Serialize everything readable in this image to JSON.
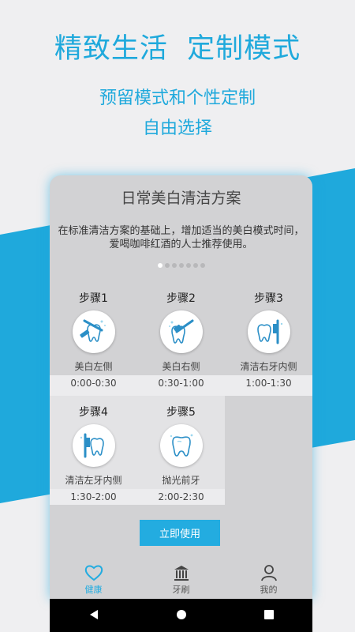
{
  "hero": {
    "title": "精致生活  定制模式",
    "subtitle1": "预留模式和个性定制",
    "subtitle2": "自由选择"
  },
  "card": {
    "title": "日常美白清洁方案",
    "description": "在标准清洁方案的基础上，增加适当的美白模式时间，爱喝咖啡红酒的人士推荐使用。",
    "dot_count": 7,
    "active_dot": 0
  },
  "steps": [
    {
      "label": "步骤1",
      "name": "美白左侧",
      "time": "0:00-0:30",
      "icon": "brush-left-tooth-icon"
    },
    {
      "label": "步骤2",
      "name": "美白右侧",
      "time": "0:30-1:00",
      "icon": "brush-right-tooth-icon"
    },
    {
      "label": "步骤3",
      "name": "清洁右牙内侧",
      "time": "1:00-1:30",
      "icon": "brush-inner-right-icon"
    },
    {
      "label": "步骤4",
      "name": "清洁左牙内侧",
      "time": "1:30-2:00",
      "icon": "brush-inner-left-icon"
    },
    {
      "label": "步骤5",
      "name": "抛光前牙",
      "time": "2:00-2:30",
      "icon": "polish-tooth-icon"
    }
  ],
  "action": {
    "use_label": "立即使用"
  },
  "tabs": [
    {
      "label": "健康",
      "icon": "heart-icon",
      "active": true
    },
    {
      "label": "牙刷",
      "icon": "toothbrush-stand-icon",
      "active": false
    },
    {
      "label": "我的",
      "icon": "person-icon",
      "active": false
    }
  ],
  "colors": {
    "accent": "#1fa9dc",
    "card_bg": "#d2d2d4"
  }
}
